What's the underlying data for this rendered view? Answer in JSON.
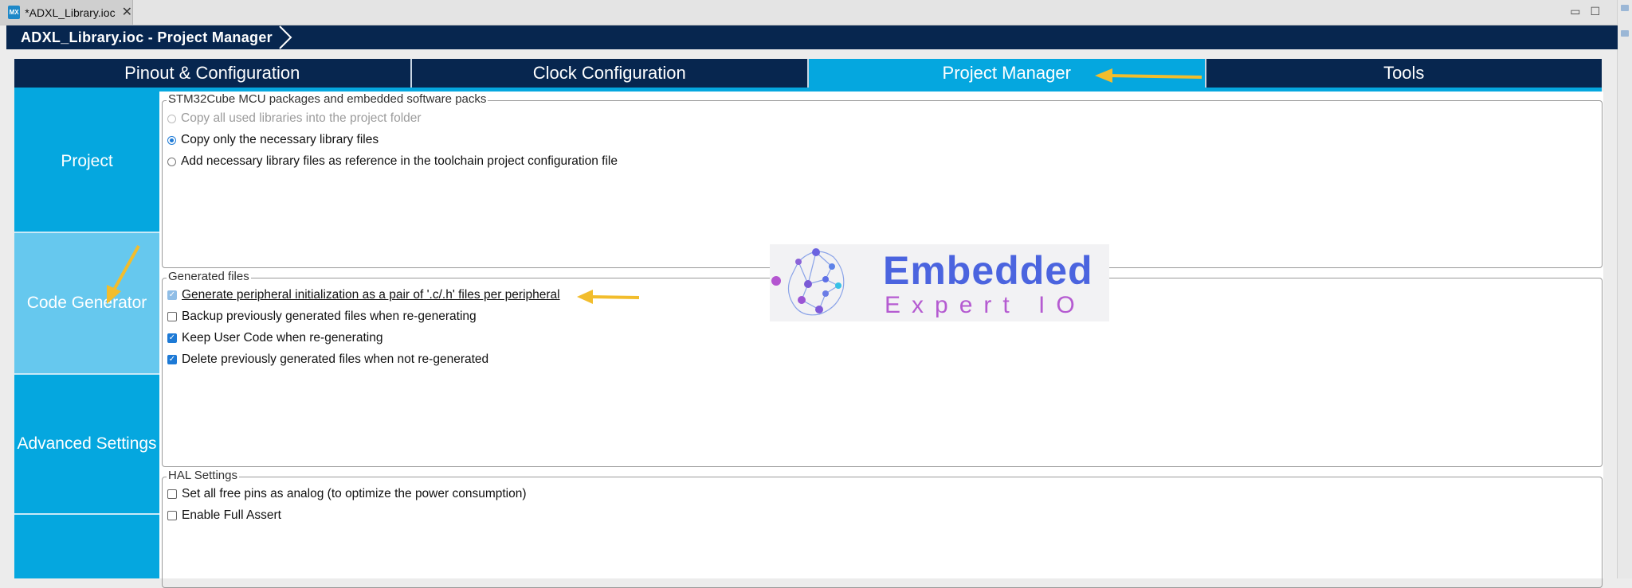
{
  "editor_tab": {
    "icon": "MX",
    "title": "*ADXL_Library.ioc",
    "close": "✕"
  },
  "window_controls": {
    "minimize": "▭",
    "maximize": "☐"
  },
  "breadcrumb": {
    "title": "ADXL_Library.ioc - Project Manager"
  },
  "main_tabs": [
    {
      "label": "Pinout & Configuration",
      "active": false
    },
    {
      "label": "Clock Configuration",
      "active": false
    },
    {
      "label": "Project Manager",
      "active": true
    },
    {
      "label": "Tools",
      "active": false
    }
  ],
  "sidebar": {
    "items": [
      {
        "label": "Project",
        "selected": false
      },
      {
        "label": "Code Generator",
        "selected": true
      },
      {
        "label": "Advanced Settings",
        "selected": false
      },
      {
        "label": "",
        "selected": false
      }
    ]
  },
  "packages": {
    "title": "STM32Cube MCU packages and embedded software packs",
    "options": [
      {
        "label": "Copy all used libraries into the project folder",
        "checked": false,
        "enabled": false
      },
      {
        "label": "Copy only the necessary library files",
        "checked": true,
        "enabled": true
      },
      {
        "label": "Add necessary library files as reference in the toolchain project configuration file",
        "checked": false,
        "enabled": true
      }
    ]
  },
  "generated_files": {
    "title": "Generated files",
    "options": [
      {
        "label": "Generate peripheral initialization as a pair of '.c/.h' files per peripheral",
        "checked": true
      },
      {
        "label": "Backup previously generated files when re-generating",
        "checked": false
      },
      {
        "label": "Keep User Code when re-generating",
        "checked": true
      },
      {
        "label": "Delete previously generated files when not re-generated",
        "checked": true
      }
    ]
  },
  "hal_settings": {
    "title": "HAL Settings",
    "options": [
      {
        "label": "Set all free pins as analog (to optimize the power consumption)",
        "checked": false
      },
      {
        "label": "Enable Full Assert",
        "checked": false
      }
    ]
  },
  "watermark": {
    "title": "Embedded",
    "subtitle": "Expert IO"
  },
  "colors": {
    "header_navy": "#07264f",
    "active_cyan": "#05a7df",
    "selected_light": "#66c8ee",
    "annotation_arrow": "#f2bd2c",
    "logo_blue": "#4b64df",
    "logo_purple": "#b55bd1"
  }
}
